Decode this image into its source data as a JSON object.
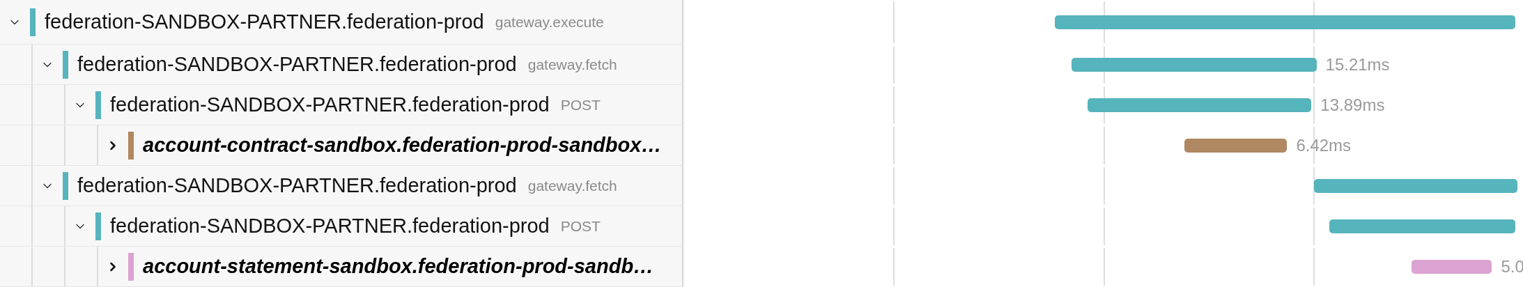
{
  "spans": [
    {
      "name": "federation-SANDBOX-PARTNER.federation-prod",
      "operation": "gateway.execute",
      "kind": "span",
      "expanded": true,
      "color": "#56b4bc",
      "children": [
        {
          "name": "federation-SANDBOX-PARTNER.federation-prod",
          "operation": "gateway.fetch",
          "kind": "span",
          "expanded": true,
          "color": "#56b4bc",
          "duration": "15.21ms",
          "children": [
            {
              "name": "federation-SANDBOX-PARTNER.federation-prod",
              "operation": "POST",
              "kind": "span",
              "expanded": true,
              "color": "#56b4bc",
              "duration": "13.89ms",
              "children": [
                {
                  "name": "account-contract-sandbox.federation-prod-sandbox…",
                  "kind": "service",
                  "expanded": false,
                  "color": "#b08862",
                  "duration": "6.42ms"
                }
              ]
            }
          ]
        },
        {
          "name": "federation-SANDBOX-PARTNER.federation-prod",
          "operation": "gateway.fetch",
          "kind": "span",
          "expanded": true,
          "color": "#56b4bc",
          "children": [
            {
              "name": "federation-SANDBOX-PARTNER.federation-prod",
              "operation": "POST",
              "kind": "span",
              "expanded": true,
              "color": "#56b4bc",
              "children": [
                {
                  "name": "account-statement-sandbox.federation-prod-sandb…",
                  "kind": "service",
                  "expanded": false,
                  "color": "#dca3d2",
                  "duration": "5.0"
                }
              ]
            }
          ]
        }
      ]
    }
  ]
}
